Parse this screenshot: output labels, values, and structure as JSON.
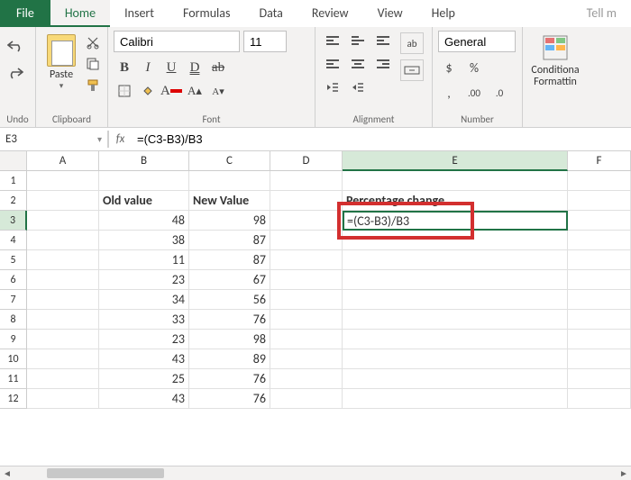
{
  "tabs": {
    "file": "File",
    "home": "Home",
    "insert": "Insert",
    "formulas": "Formulas",
    "data": "Data",
    "review": "Review",
    "view": "View",
    "help": "Help",
    "tellme": "Tell m"
  },
  "groups": {
    "undo": "Undo",
    "clipboard": "Clipboard",
    "font": "Font",
    "alignment": "Alignment",
    "number": "Number"
  },
  "paste_label": "Paste",
  "font": {
    "name": "Calibri",
    "size": "11"
  },
  "number_format": "General",
  "cond_label": "Conditiona\nFormattin",
  "name_box": "E3",
  "fx": "fx",
  "formula": "=(C3-B3)/B3",
  "cols": {
    "A": "A",
    "B": "B",
    "C": "C",
    "D": "D",
    "E": "E",
    "F": "F"
  },
  "headers": {
    "old": "Old value",
    "new": "New Value",
    "pct": "Percentage change"
  },
  "data_rows": [
    {
      "r": "3",
      "b": "48",
      "c": "98"
    },
    {
      "r": "4",
      "b": "38",
      "c": "87"
    },
    {
      "r": "5",
      "b": "11",
      "c": "87"
    },
    {
      "r": "6",
      "b": "23",
      "c": "67"
    },
    {
      "r": "7",
      "b": "34",
      "c": "56"
    },
    {
      "r": "8",
      "b": "33",
      "c": "76"
    },
    {
      "r": "9",
      "b": "23",
      "c": "98"
    },
    {
      "r": "10",
      "b": "43",
      "c": "89"
    },
    {
      "r": "11",
      "b": "25",
      "c": "76"
    },
    {
      "r": "12",
      "b": "43",
      "c": "76"
    }
  ],
  "editing_cell": "=(C3-B3)/B3",
  "row1": "1",
  "row2": "2"
}
